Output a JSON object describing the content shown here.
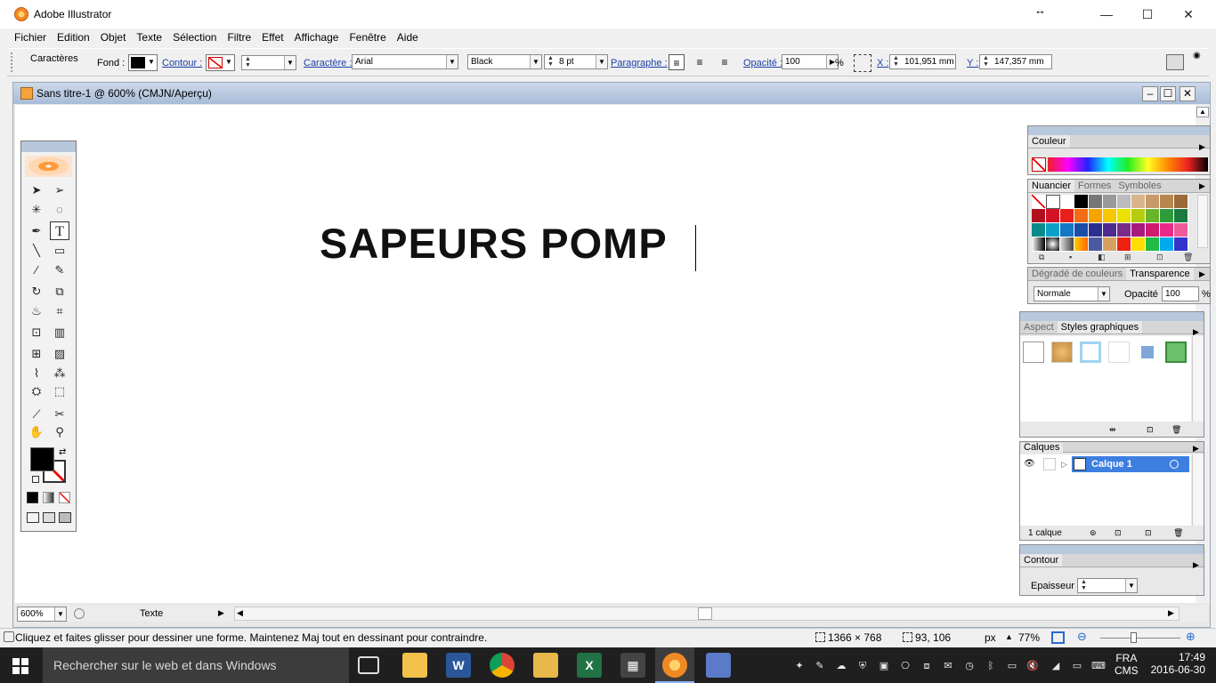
{
  "window": {
    "title": "Adobe Illustrator",
    "minimize": "—",
    "maximize": "☐",
    "close": "✕",
    "resize_glyph": "↔"
  },
  "menu": [
    "Fichier",
    "Edition",
    "Objet",
    "Texte",
    "Sélection",
    "Filtre",
    "Effet",
    "Affichage",
    "Fenêtre",
    "Aide"
  ],
  "control_bar": {
    "section": "Caractères",
    "fill_label": "Fond :",
    "stroke_label": "Contour :",
    "character_label": "Caractère :",
    "font_family": "Arial",
    "font_style": "Black",
    "font_size": "8 pt",
    "paragraph_label": "Paragraphe :",
    "opacity_label": "Opacité :",
    "opacity_value": "100",
    "percent": "%",
    "x_label": "X :",
    "x_value": "101,951 mm",
    "y_label": "Y :",
    "y_value": "147,357 mm"
  },
  "document": {
    "title": "Sans titre-1 @ 600% (CMJN/Aperçu)",
    "text": "SAPEURS POMP",
    "zoom": "600%",
    "status_field": "Texte"
  },
  "panels": {
    "color": {
      "tab": "Couleur"
    },
    "swatches": {
      "tabs": [
        "Nuancier",
        "Formes",
        "Symboles"
      ]
    },
    "transparency": {
      "tabs": [
        "Dégradé de couleurs",
        "Transparence"
      ],
      "blend_mode": "Normale",
      "opacity_label": "Opacité",
      "opacity_value": "100",
      "percent": "%"
    },
    "styles": {
      "tabs": [
        "Aspect",
        "Styles graphiques"
      ]
    },
    "layers": {
      "tab": "Calques",
      "layer_name": "Calque 1",
      "count": "1 calque"
    },
    "stroke": {
      "tab": "Contour",
      "weight_label": "Epaisseur :"
    }
  },
  "status_bar": {
    "hint": "Cliquez et faites glisser pour dessiner une forme. Maintenez Maj tout en dessinant pour contraindre.",
    "dimensions": "1366 × 768",
    "coords": "93, 106",
    "unit": "px",
    "zoom": "77%"
  },
  "taskbar": {
    "search_placeholder": "Rechercher sur le web et dans Windows",
    "lang1": "FRA",
    "lang2": "CMS",
    "time": "17:49",
    "date": "2016-06-30"
  },
  "colors": {
    "accent": "#1a3fa8",
    "panel_head": "#b8c8dc",
    "layer_highlight": "#3d7fe0",
    "taskbar": "#1f1f1f"
  }
}
